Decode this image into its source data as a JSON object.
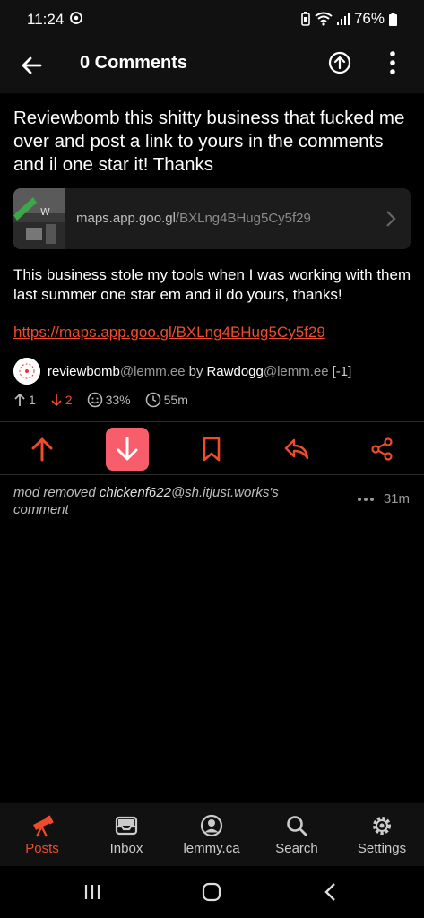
{
  "status_bar": {
    "time": "11:24",
    "battery": "76%"
  },
  "top_bar": {
    "title": "0 Comments"
  },
  "post": {
    "title": "Reviewbomb this shitty business that fucked me over and post a link to yours in the comments and il one star it! Thanks",
    "link_card": {
      "domain": "maps.app.goo.gl",
      "path": "/BXLng4BHug5Cy5f29"
    },
    "body": "This business stole my tools when I was working with them last summer one star em and il do yours, thanks!",
    "body_link": "https://maps.app.goo.gl/BXLng4BHug5Cy5f29",
    "community_name": "reviewbomb",
    "community_instance": "@lemm.ee",
    "by_label": "by",
    "author_name": "Rawdogg",
    "author_instance": "@lemm.ee",
    "author_score": "[-1]",
    "upvotes": "1",
    "downvotes": "2",
    "percent": "33%",
    "age": "55m"
  },
  "comment": {
    "prefix": "mod removed ",
    "user": "chickenf622",
    "instance": "@sh.itjust.works",
    "suffix": "'s comment",
    "age": "31m"
  },
  "nav": {
    "items": [
      {
        "label": "Posts",
        "icon": "telescope-icon",
        "active": true
      },
      {
        "label": "Inbox",
        "icon": "inbox-icon",
        "active": false
      },
      {
        "label": "lemmy.ca",
        "icon": "account-icon",
        "active": false
      },
      {
        "label": "Search",
        "icon": "search-icon",
        "active": false
      },
      {
        "label": "Settings",
        "icon": "gear-icon",
        "active": false
      }
    ]
  },
  "colors": {
    "accent": "#ef4b2c",
    "downvote_active_bg": "#f85d6c",
    "background": "#000000",
    "bar_background": "#111111"
  }
}
